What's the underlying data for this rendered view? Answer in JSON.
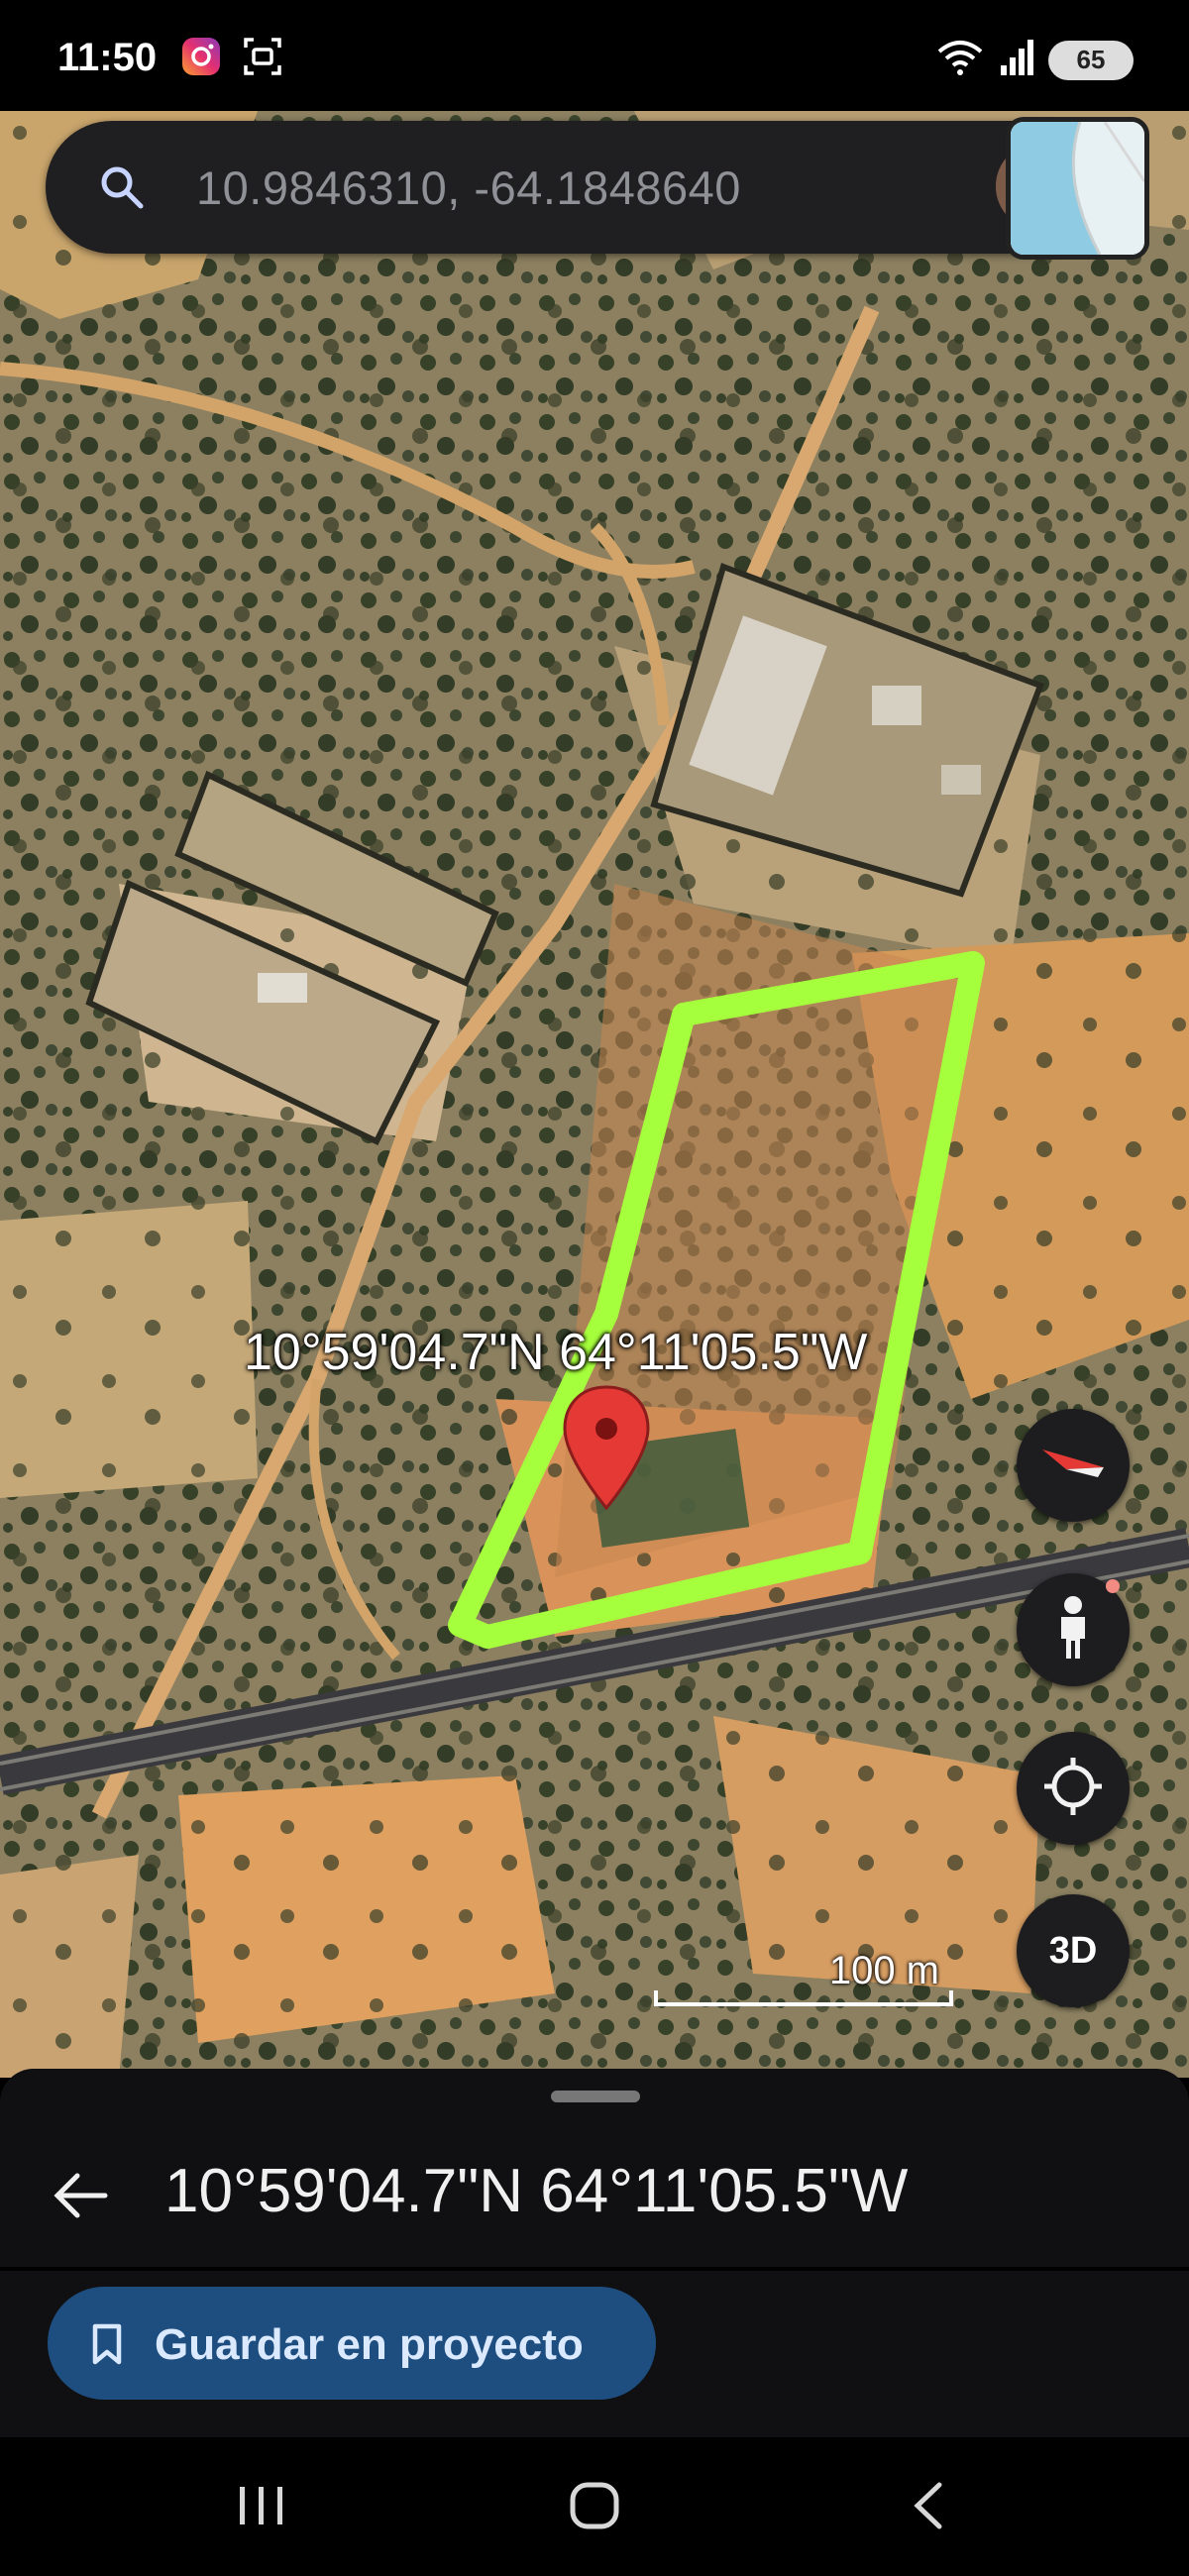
{
  "status_bar": {
    "time": "11:50",
    "battery": "65",
    "icons": [
      "instagram-icon",
      "screenshot-icon",
      "wifi-icon",
      "signal-icon"
    ]
  },
  "search": {
    "query": "10.9846310, -64.1848640"
  },
  "map": {
    "type": "satellite",
    "coordinate_label": "10°59'04.7\"N 64°11'05.5\"W",
    "marker_color": "#e53935",
    "outline_color": "#a6ff3c",
    "scale_label": "100 m",
    "buttons": {
      "three_d_label": "3D",
      "icons": [
        "compass-icon",
        "street-view-icon",
        "my-location-icon"
      ]
    }
  },
  "place_sheet": {
    "title": "10°59'04.7\"N 64°11'05.5\"W",
    "save_button_label": "Guardar en proyecto",
    "save_button_color": "#1e4e7f"
  },
  "nav_bar": {
    "buttons": [
      "recent-apps-icon",
      "home-icon",
      "back-icon"
    ]
  }
}
